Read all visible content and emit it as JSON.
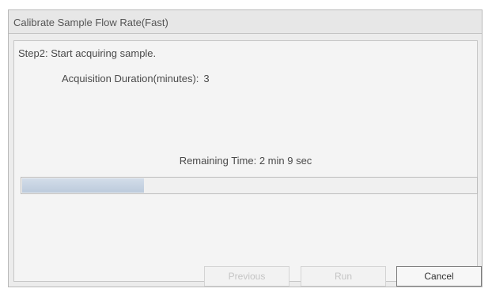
{
  "window": {
    "title": "Calibrate Sample Flow Rate(Fast)"
  },
  "step": {
    "text": "Step2: Start acquiring sample."
  },
  "acquisition": {
    "label": "Acquisition Duration(minutes):",
    "value": "3"
  },
  "remaining": {
    "text": "Remaining Time: 2 min 9 sec"
  },
  "progress": {
    "fraction": 0.27
  },
  "buttons": {
    "previous_label": "Previous",
    "run_label": "Run",
    "cancel_label": "Cancel"
  },
  "colors": {
    "progress_fill": "#c6d3e2",
    "dialog_background": "#ececec"
  }
}
